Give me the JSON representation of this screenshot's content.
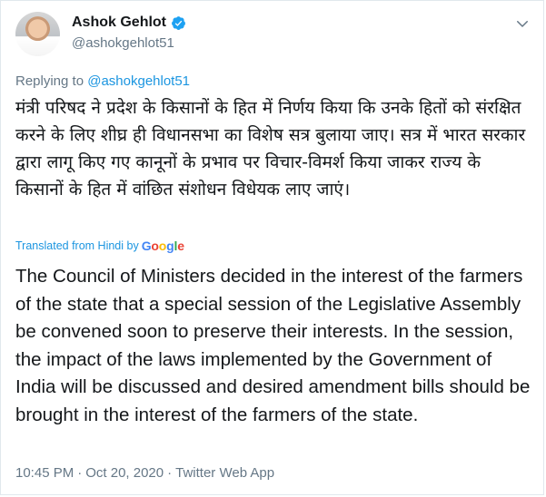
{
  "author": {
    "display_name": "Ashok Gehlot",
    "handle": "@ashokgehlot51",
    "verified_icon": "verified-badge-icon",
    "avatar": "profile-photo"
  },
  "reply": {
    "prefix": "Replying to",
    "mention": "@ashokgehlot51"
  },
  "tweet": {
    "original_text": "मंत्री परिषद ने प्रदेश के किसानों के हित में निर्णय किया कि उनके हितों को संरक्षित करने के लिए शीघ्र ही विधानसभा का विशेष सत्र बुलाया जाए। सत्र में भारत सरकार द्वारा लागू किए गए कानूनों के प्रभाव पर विचार-विमर्श किया जाकर राज्य के किसानों के हित में वांछित संशोधन विधेयक लाए जाएं।",
    "translated_label": "Translated from Hindi by",
    "translation_provider": "Google",
    "translated_text": "The Council of Ministers decided in the interest of the farmers of the state that a special session of the Legislative Assembly be convened soon to preserve their interests. In the session, the impact of the laws implemented by the Government of India will be discussed and desired amendment bills should be brought in the interest of the farmers of the state."
  },
  "meta": {
    "time": "10:45 PM",
    "separator": "·",
    "date": "Oct 20, 2020",
    "source": "Twitter Web App"
  },
  "colors": {
    "link": "#1b95e0",
    "secondary_text": "#657786",
    "verified": "#1da1f2"
  }
}
